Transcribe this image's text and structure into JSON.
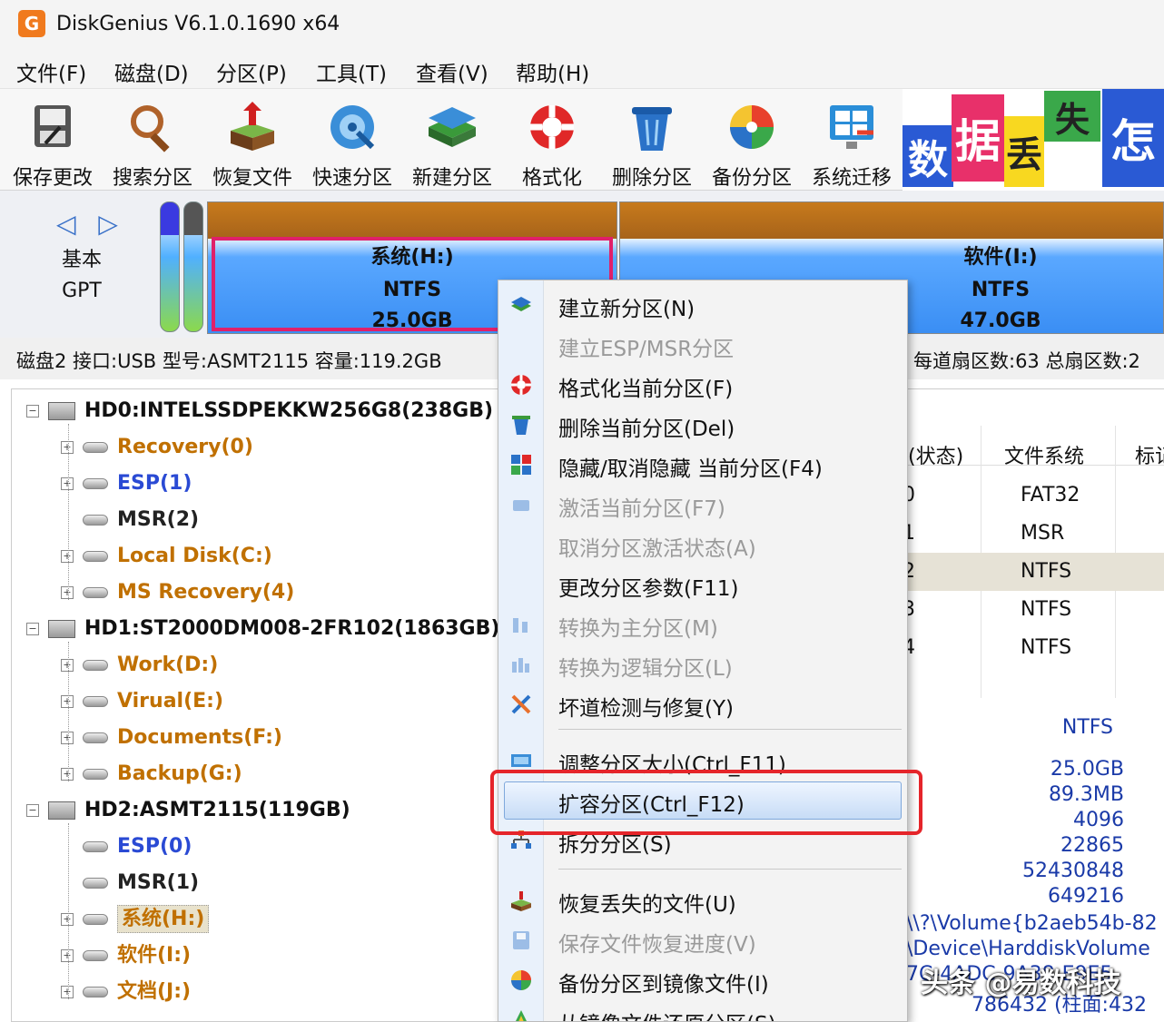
{
  "window": {
    "title": "DiskGenius V6.1.0.1690 x64",
    "logo": "G"
  },
  "menu": [
    "文件(F)",
    "磁盘(D)",
    "分区(P)",
    "工具(T)",
    "查看(V)",
    "帮助(H)"
  ],
  "toolbar": [
    {
      "label": "保存更改",
      "icon": "save-icon"
    },
    {
      "label": "搜索分区",
      "icon": "magnifier-icon"
    },
    {
      "label": "恢复文件",
      "icon": "recover-files-icon"
    },
    {
      "label": "快速分区",
      "icon": "quick-partition-icon"
    },
    {
      "label": "新建分区",
      "icon": "new-partition-icon"
    },
    {
      "label": "格式化",
      "icon": "lifebuoy-icon"
    },
    {
      "label": "删除分区",
      "icon": "trash-icon"
    },
    {
      "label": "备份分区",
      "icon": "backup-disc-icon"
    },
    {
      "label": "系统迁移",
      "icon": "windows-migrate-icon"
    }
  ],
  "banner": {
    "chars": [
      "数",
      "据",
      "丢",
      "失",
      "怎"
    ]
  },
  "disk_map": {
    "nav_arrows": "◁ ▷",
    "disk_type": "基本",
    "partition_style": "GPT",
    "partitions": [
      {
        "name": "系统(H:)",
        "fs": "NTFS",
        "size": "25.0GB",
        "selected": true
      },
      {
        "name": "软件(I:)",
        "fs": "NTFS",
        "size": "47.0GB",
        "selected": false
      }
    ]
  },
  "disk_info": {
    "left": "磁盘2 接口:USB  型号:ASMT2115  容量:119.2GB",
    "right": "每道扇区数:63  总扇区数:2"
  },
  "tree": [
    {
      "label": "HD0:INTELSSDPEKKW256G8(238GB)",
      "level": 0,
      "type": "disk",
      "expander": "−"
    },
    {
      "label": "Recovery(0)",
      "level": 1,
      "type": "part",
      "expander": "+",
      "color": "#c07000"
    },
    {
      "label": "ESP(1)",
      "level": 1,
      "type": "part",
      "expander": "+",
      "color": "#2a4ad4"
    },
    {
      "label": "MSR(2)",
      "level": 1,
      "type": "part",
      "expander": "",
      "color": "#222222"
    },
    {
      "label": "Local Disk(C:)",
      "level": 1,
      "type": "part",
      "expander": "+",
      "color": "#c07000"
    },
    {
      "label": "MS Recovery(4)",
      "level": 1,
      "type": "part",
      "expander": "+",
      "color": "#c07000"
    },
    {
      "label": "HD1:ST2000DM008-2FR102(1863GB)",
      "level": 0,
      "type": "disk",
      "expander": "−"
    },
    {
      "label": "Work(D:)",
      "level": 1,
      "type": "part",
      "expander": "+",
      "color": "#c07000"
    },
    {
      "label": "Virual(E:)",
      "level": 1,
      "type": "part",
      "expander": "+",
      "color": "#c07000"
    },
    {
      "label": "Documents(F:)",
      "level": 1,
      "type": "part",
      "expander": "+",
      "color": "#c07000"
    },
    {
      "label": "Backup(G:)",
      "level": 1,
      "type": "part",
      "expander": "+",
      "color": "#c07000"
    },
    {
      "label": "HD2:ASMT2115(119GB)",
      "level": 0,
      "type": "disk",
      "expander": "−"
    },
    {
      "label": "ESP(0)",
      "level": 1,
      "type": "part",
      "expander": "",
      "color": "#2a4ad4"
    },
    {
      "label": "MSR(1)",
      "level": 1,
      "type": "part",
      "expander": "",
      "color": "#222222"
    },
    {
      "label": "系统(H:)",
      "level": 1,
      "type": "part",
      "expander": "+",
      "color": "#c07000",
      "selected": true
    },
    {
      "label": "软件(I:)",
      "level": 1,
      "type": "part",
      "expander": "+",
      "color": "#c07000"
    },
    {
      "label": "文档(J:)",
      "level": 1,
      "type": "part",
      "expander": "+",
      "color": "#c07000"
    }
  ],
  "right_panel": {
    "columns": [
      "(状态)",
      "文件系统",
      "标记"
    ],
    "rows": [
      {
        "idx": "0",
        "fs": "FAT32"
      },
      {
        "idx": "1",
        "fs": "MSR"
      },
      {
        "idx": "2",
        "fs": "NTFS"
      },
      {
        "idx": "3",
        "fs": "NTFS"
      },
      {
        "idx": "4",
        "fs": "NTFS"
      }
    ],
    "details": [
      "NTFS",
      "25.0GB",
      "89.3MB",
      "4096",
      "22865",
      "52430848",
      "649216"
    ],
    "paths": [
      "\\\\?\\Volume{b2aeb54b-82",
      "\\Device\\HarddiskVolume",
      "7C-4ADC-9A38-E9E5",
      "786432 (柱面:432"
    ]
  },
  "context_menu": [
    {
      "label": "建立新分区(N)",
      "icon": "new-partition-icon",
      "disabled": false
    },
    {
      "label": "建立ESP/MSR分区",
      "icon": "",
      "disabled": true
    },
    {
      "label": "格式化当前分区(F)",
      "icon": "lifebuoy-icon",
      "disabled": false
    },
    {
      "label": "删除当前分区(Del)",
      "icon": "trash-icon",
      "disabled": false
    },
    {
      "label": "隐藏/取消隐藏 当前分区(F4)",
      "icon": "hide-icon",
      "disabled": false
    },
    {
      "label": "激活当前分区(F7)",
      "icon": "activate-icon",
      "disabled": true
    },
    {
      "label": "取消分区激活状态(A)",
      "icon": "",
      "disabled": true
    },
    {
      "label": "更改分区参数(F11)",
      "icon": "",
      "disabled": false
    },
    {
      "label": "转换为主分区(M)",
      "icon": "convert-primary-icon",
      "disabled": true
    },
    {
      "label": "转换为逻辑分区(L)",
      "icon": "convert-logical-icon",
      "disabled": true
    },
    {
      "label": "坏道检测与修复(Y)",
      "icon": "repair-tools-icon",
      "disabled": false
    },
    {
      "label": "调整分区大小(Ctrl_F11)",
      "icon": "resize-icon",
      "disabled": false
    },
    {
      "label": "扩容分区(Ctrl_F12)",
      "icon": "",
      "disabled": false,
      "highlighted": true
    },
    {
      "label": "拆分分区(S)",
      "icon": "split-icon",
      "disabled": false
    },
    {
      "label": "恢复丢失的文件(U)",
      "icon": "recover-files-icon",
      "disabled": false
    },
    {
      "label": "保存文件恢复进度(V)",
      "icon": "save-progress-icon",
      "disabled": true
    },
    {
      "label": "备份分区到镜像文件(I)",
      "icon": "backup-disc-icon",
      "disabled": false
    },
    {
      "label": "从镜像文件还原分区(S)",
      "icon": "restore-icon",
      "disabled": false
    }
  ],
  "watermark": "头条 @易数科技",
  "colors": {
    "accent": "#3a8ef4",
    "highlight_border": "#e5252a",
    "partition_text": "#c07000",
    "system_text": "#2a4ad4"
  }
}
